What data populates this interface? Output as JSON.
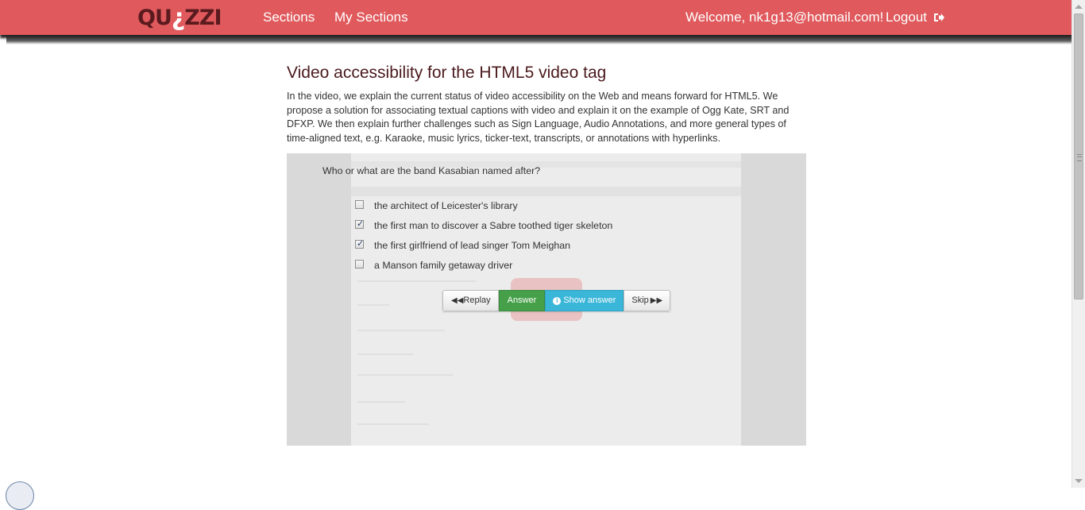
{
  "navbar": {
    "logo": {
      "before": "QU",
      "mark": "¿",
      "after": "ZZI"
    },
    "links": {
      "sections": "Sections",
      "my_sections": "My Sections"
    },
    "welcome": "Welcome, nk1g13@hotmail.com!",
    "logout": "Logout",
    "accent_color": "#e05a5d"
  },
  "video": {
    "title": "Video accessibility for the HTML5 video tag",
    "description": "In the video, we explain the current status of video accessibility on the Web and means forward for HTML5. We propose a solution for associating textual captions with video and explain it on the example of Ogg Kate, SRT and DFXP. We then explain further challenges such as Sign Language, Audio Annotations, and more general types of time-aligned text, e.g. Karaoke, music lyrics, ticker-text, transcripts, or annotations with hyperlinks."
  },
  "quiz": {
    "question": "Who or what are the band Kasabian named after?",
    "options": [
      {
        "label": "the architect of Leicester's library",
        "checked": false
      },
      {
        "label": "the first man to discover a Sabre toothed tiger skeleton",
        "checked": true
      },
      {
        "label": "the first girlfriend of lead singer Tom Meighan",
        "checked": true
      },
      {
        "label": "a Manson family getaway driver",
        "checked": false
      }
    ],
    "buttons": {
      "replay": "Replay",
      "answer": "Answer",
      "show_answer": "Show answer",
      "skip": "Skip"
    },
    "colors": {
      "answer": "#46a049",
      "show_answer": "#3ab6d8"
    }
  }
}
